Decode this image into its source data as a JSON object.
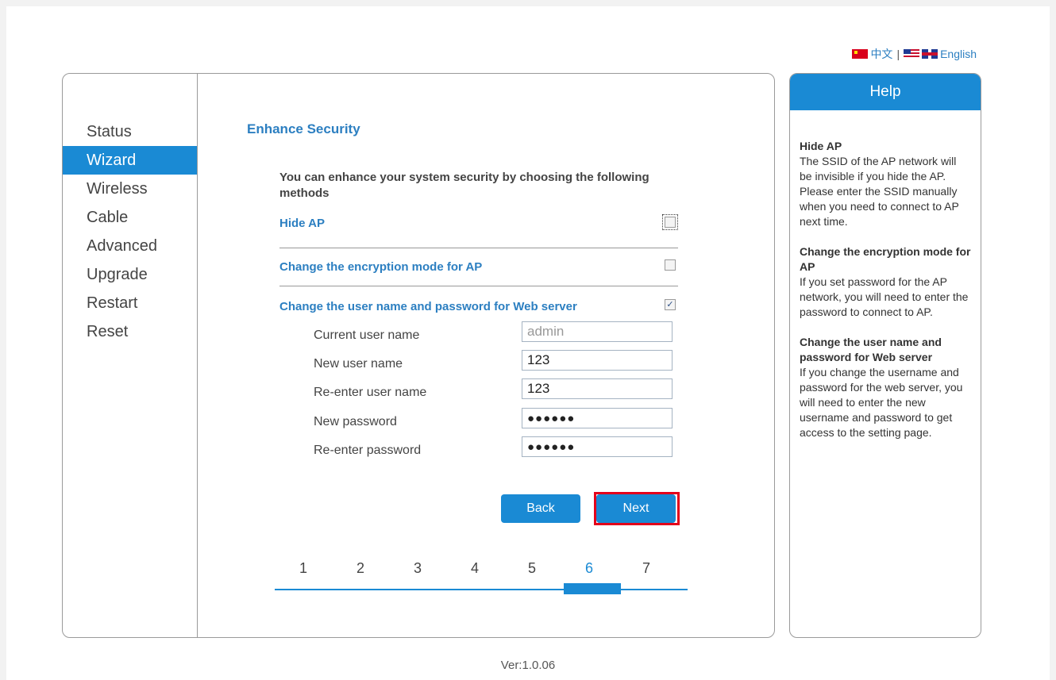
{
  "lang": {
    "chinese": "中文",
    "separator": "|",
    "english": "English"
  },
  "nav": {
    "items": [
      {
        "label": "Status",
        "active": false
      },
      {
        "label": "Wizard",
        "active": true
      },
      {
        "label": "Wireless",
        "active": false
      },
      {
        "label": "Cable",
        "active": false
      },
      {
        "label": "Advanced",
        "active": false
      },
      {
        "label": "Upgrade",
        "active": false
      },
      {
        "label": "Restart",
        "active": false
      },
      {
        "label": "Reset",
        "active": false
      }
    ]
  },
  "main": {
    "title": "Enhance Security",
    "intro": "You can enhance your system security by choosing the following methods",
    "options": [
      {
        "label": "Hide AP",
        "checked": false
      },
      {
        "label": "Change the encryption mode for AP",
        "checked": false
      },
      {
        "label": "Change the user name and password for Web server",
        "checked": true
      }
    ],
    "fields": [
      {
        "label": "Current user name",
        "value": "admin"
      },
      {
        "label": "New user name",
        "value": "123"
      },
      {
        "label": "Re-enter user name",
        "value": "123"
      },
      {
        "label": "New password",
        "value": "●●●●●●"
      },
      {
        "label": "Re-enter password",
        "value": "●●●●●●"
      }
    ],
    "back_label": "Back",
    "next_label": "Next",
    "steps": [
      "1",
      "2",
      "3",
      "4",
      "5",
      "6",
      "7"
    ],
    "current_step": "6"
  },
  "help": {
    "title": "Help",
    "sections": [
      {
        "heading": "Hide AP",
        "text": "The SSID of the AP network will be invisible if you hide the AP. Please enter the SSID manually when you need to connect to AP next time."
      },
      {
        "heading": "Change the encryption mode for AP",
        "text": "If you set password for the AP network, you will need to enter the password to connect to AP."
      },
      {
        "heading": "Change the user name and password for Web server",
        "text": "If you change the username and password for the web server, you will need to enter the new username and password to get access to the setting page."
      }
    ]
  },
  "footer": {
    "version": "Ver:1.0.06"
  },
  "colors": {
    "accent": "#1a8ad4",
    "link": "#2c7fc1",
    "highlight": "#e3001b"
  }
}
